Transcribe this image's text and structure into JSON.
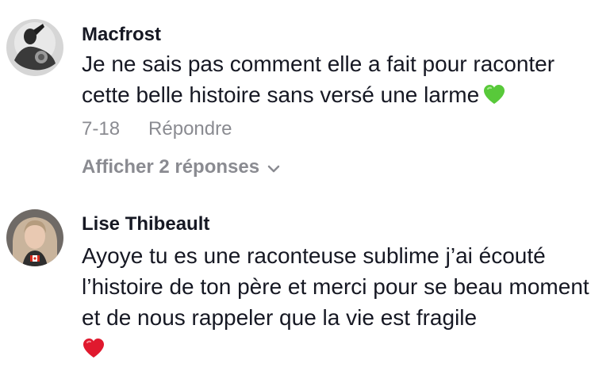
{
  "comments": [
    {
      "username": "Macfrost",
      "text": "Je ne sais pas comment elle a fait pour raconter cette belle histoire sans versé une larme",
      "emoji_icon": "green-heart-icon",
      "date": "7-18",
      "reply_label": "Répondre",
      "view_replies_label": "Afficher 2 réponses"
    },
    {
      "username": "Lise Thibeault",
      "text": "Ayoye tu es une raconteuse sublime j’ai écouté l’histoire de ton père et merci pour se beau moment et de nous rappeler que la vie est fragile",
      "emoji_icon": "red-heart-icon"
    }
  ],
  "colors": {
    "primary_text": "#161823",
    "secondary_text": "#8a8b91",
    "green_heart": "#58c93a",
    "red_heart": "#e0192e"
  }
}
